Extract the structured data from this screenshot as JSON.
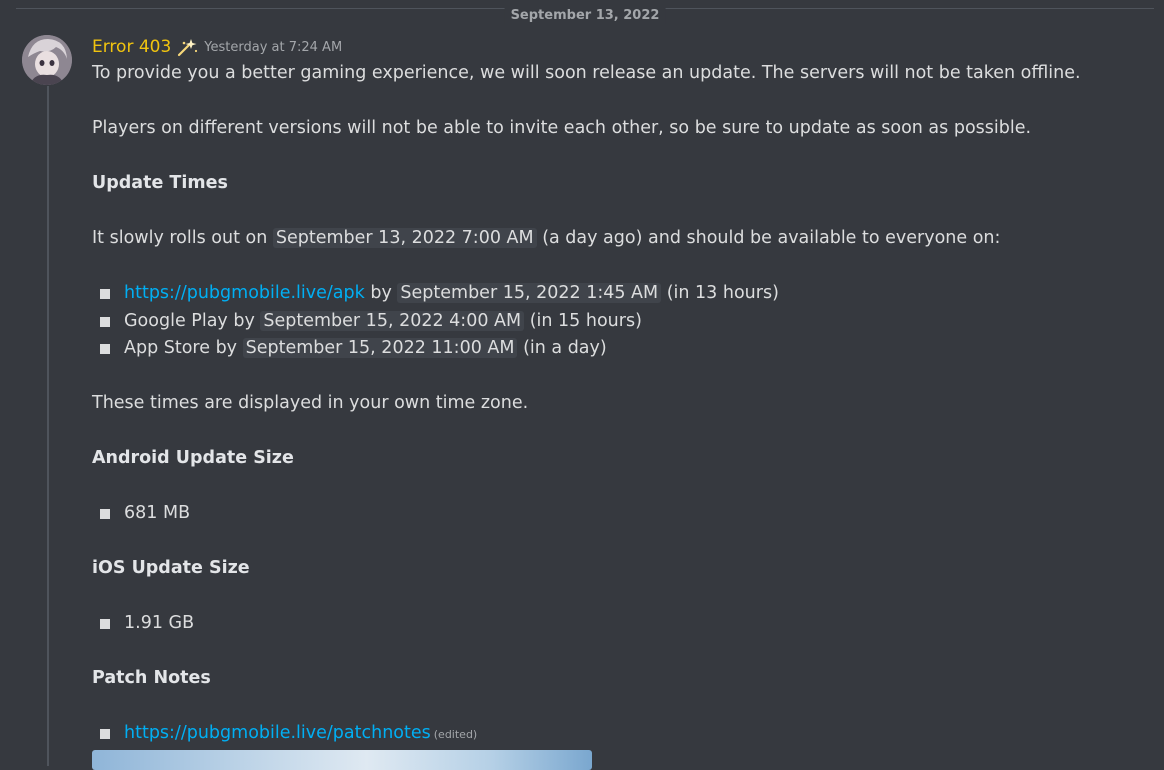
{
  "date_divider": "September 13, 2022",
  "message": {
    "username": "Error 403",
    "timestamp": "Yesterday at 7:24 AM",
    "para1": "To provide you a better gaming experience, we will soon release an update. The servers will not be taken offline.",
    "para2": "Players on different versions will not be able to invite each other, so be sure to update as soon as possible.",
    "heading_update_times": "Update Times",
    "rollout_prefix": "It slowly rolls out on",
    "rollout_timestamp": "September 13, 2022 7:00 AM",
    "rollout_relative": "a day ago",
    "rollout_suffix": "and should be available to everyone on:",
    "schedule": [
      {
        "prefix_link": "https://pubgmobile.live/apk",
        "by": "by",
        "timestamp": "September 15, 2022 1:45 AM",
        "relative": "in 13 hours"
      },
      {
        "prefix_text": "Google Play by",
        "timestamp": "September 15, 2022 4:00 AM",
        "relative": "in 15 hours"
      },
      {
        "prefix_text": "App Store by",
        "timestamp": "September 15, 2022 11:00 AM",
        "relative": "in a day"
      }
    ],
    "timezone_note": "These times are displayed in your own time zone.",
    "heading_android": "Android Update Size",
    "android_size": "681 MB",
    "heading_ios": "iOS Update Size",
    "ios_size": "1.91 GB",
    "heading_patch": "Patch Notes",
    "patch_link": "https://pubgmobile.live/patchnotes",
    "edited_label": "(edited)"
  }
}
